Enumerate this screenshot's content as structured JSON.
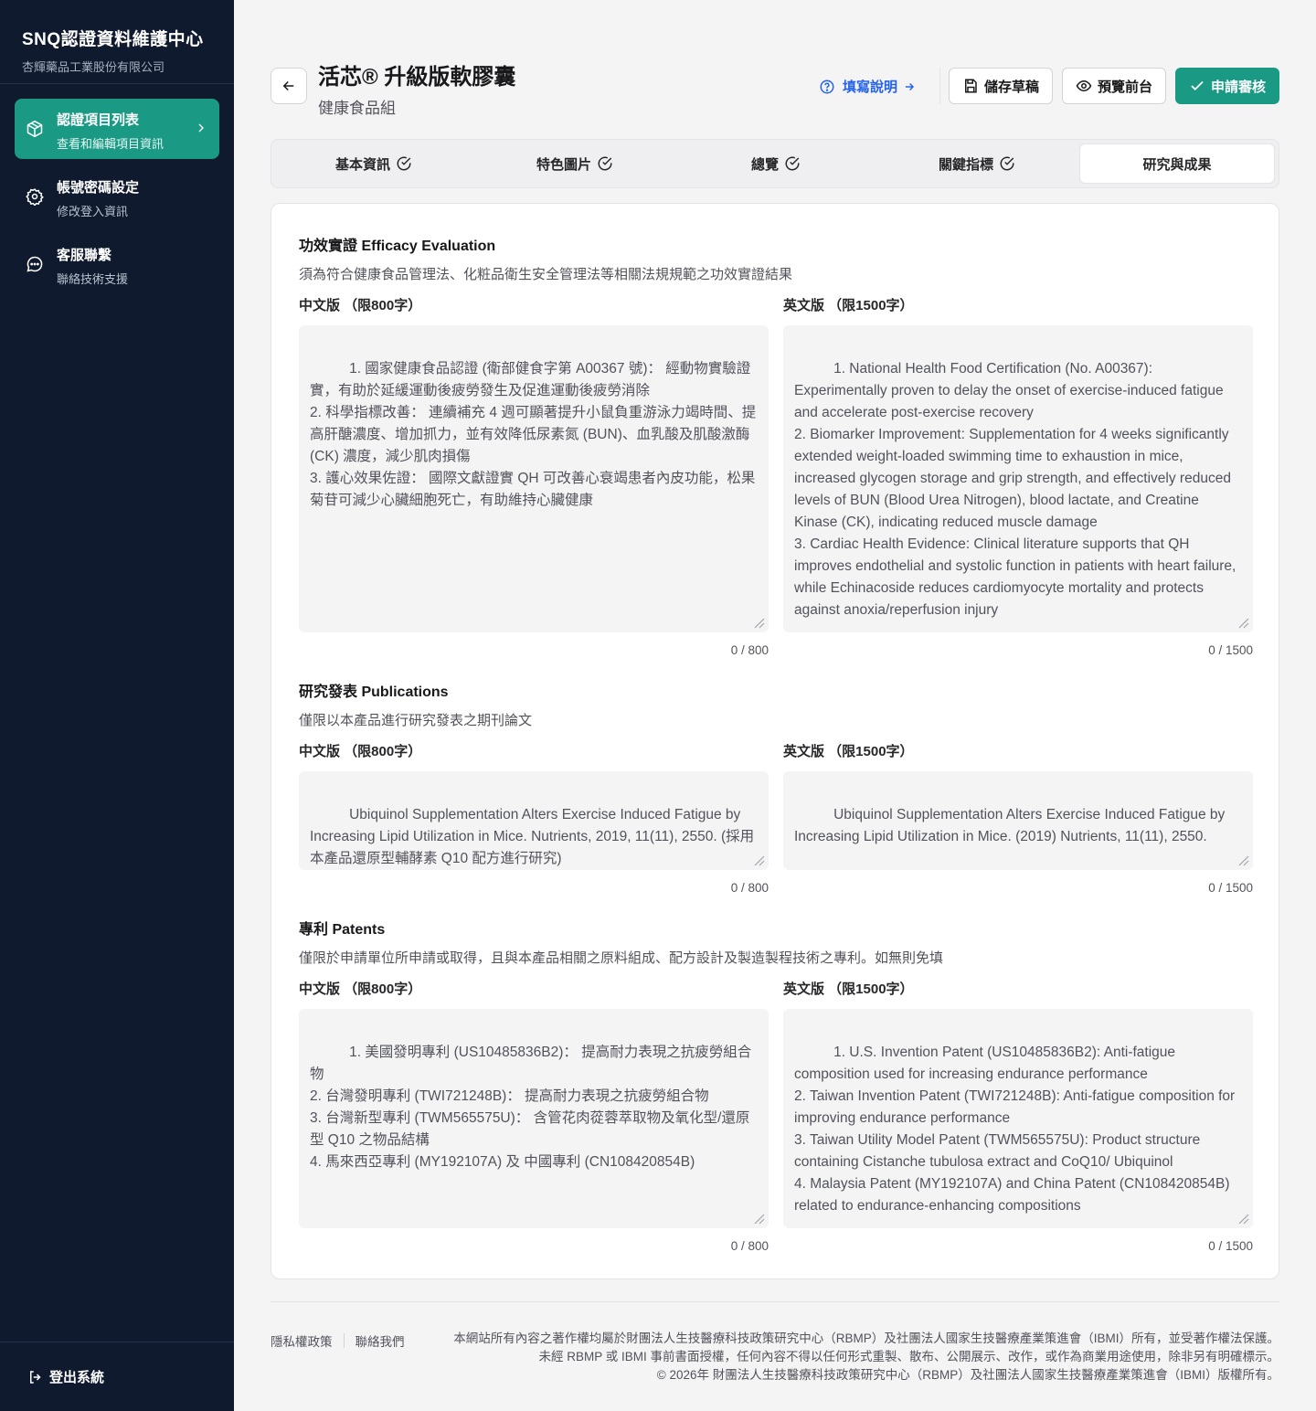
{
  "sidebar": {
    "brand_title": "SNQ認證資料維護中心",
    "brand_sub": "杏輝藥品工業股份有限公司",
    "items": [
      {
        "label": "認證項目列表",
        "sub": "查看和編輯項目資訊",
        "icon": "box-icon",
        "active": true
      },
      {
        "label": "帳號密碼設定",
        "sub": "修改登入資訊",
        "icon": "gear-icon",
        "active": false
      },
      {
        "label": "客服聯繫",
        "sub": "聯絡技術支援",
        "icon": "chat-icon",
        "active": false
      }
    ],
    "logout_label": "登出系統"
  },
  "header": {
    "title": "活芯® 升級版軟膠囊",
    "subtitle": "健康食品組",
    "help_label": "填寫說明",
    "save_label": "儲存草稿",
    "preview_label": "預覽前台",
    "submit_label": "申請審核"
  },
  "tabs": [
    {
      "label": "基本資訊",
      "done": true
    },
    {
      "label": "特色圖片",
      "done": true
    },
    {
      "label": "總覽",
      "done": true
    },
    {
      "label": "關鍵指標",
      "done": true
    },
    {
      "label": "研究與成果",
      "done": false,
      "active": true
    }
  ],
  "sections": {
    "efficacy": {
      "title": "功效實證 Efficacy Evaluation",
      "desc": "須為符合健康食品管理法、化粧品衛生安全管理法等相關法規規範之功效實證結果",
      "zh_label": "中文版 （限800字）",
      "en_label": "英文版 （限1500字）",
      "zh_text": "1. 國家健康食品認證 (衛部健食字第 A00367 號)： 經動物實驗證實，有助於延緩運動後疲勞發生及促進運動後疲勞消除\n2. 科學指標改善： 連續補充 4 週可顯著提升小鼠負重游泳力竭時間、提高肝醣濃度、增加抓力，並有效降低尿素氮 (BUN)、血乳酸及肌酸激酶 (CK) 濃度，減少肌肉損傷\n3. 護心效果佐證： 國際文獻證實 QH 可改善心衰竭患者內皮功能，松果菊苷可減少心臟細胞死亡，有助維持心臟健康",
      "en_text": "1. National Health Food Certification (No. A00367): Experimentally proven to delay the onset of exercise-induced fatigue and accelerate post-exercise recovery\n2. Biomarker Improvement: Supplementation for 4 weeks significantly extended weight-loaded swimming time to exhaustion in mice, increased glycogen storage and grip strength, and effectively reduced levels of BUN (Blood Urea Nitrogen), blood lactate, and Creatine Kinase (CK), indicating reduced muscle damage\n3. Cardiac Health Evidence: Clinical literature supports that QH improves endothelial and systolic function in patients with heart failure, while Echinacoside reduces cardiomyocyte mortality and protects against anoxia/reperfusion injury",
      "zh_count": "0 / 800",
      "en_count": "0 / 1500"
    },
    "publications": {
      "title": "研究發表 Publications",
      "desc": "僅限以本產品進行研究發表之期刊論文",
      "zh_label": "中文版 （限800字）",
      "en_label": "英文版 （限1500字）",
      "zh_text": "Ubiquinol Supplementation Alters Exercise Induced Fatigue by Increasing Lipid Utilization in Mice. Nutrients, 2019, 11(11), 2550. (採用本產品還原型輔酵素 Q10 配方進行研究)",
      "en_text": "Ubiquinol Supplementation Alters Exercise Induced Fatigue by Increasing Lipid Utilization in Mice. (2019) Nutrients, 11(11), 2550.",
      "zh_count": "0 / 800",
      "en_count": "0 / 1500"
    },
    "patents": {
      "title": "專利 Patents",
      "desc": "僅限於申請單位所申請或取得，且與本產品相關之原料組成、配方設計及製造製程技術之專利。如無則免填",
      "zh_label": "中文版 （限800字）",
      "en_label": "英文版 （限1500字）",
      "zh_text": "1. 美國發明專利 (US10485836B2)： 提高耐力表現之抗疲勞組合物\n2. 台灣發明專利 (TWI721248B)： 提高耐力表現之抗疲勞組合物\n3. 台灣新型專利 (TWM565575U)： 含管花肉蓯蓉萃取物及氧化型/還原型 Q10 之物品結構\n4. 馬來西亞專利 (MY192107A) 及 中國專利 (CN108420854B)",
      "en_text": "1. U.S. Invention Patent (US10485836B2): Anti-fatigue composition used for increasing endurance performance\n2. Taiwan Invention Patent (TWI721248B): Anti-fatigue composition for improving endurance performance\n3. Taiwan Utility Model Patent (TWM565575U): Product structure containing Cistanche tubulosa extract and CoQ10/ Ubiquinol\n4. Malaysia Patent (MY192107A) and China Patent (CN108420854B) related to endurance-enhancing compositions",
      "zh_count": "0 / 800",
      "en_count": "0 / 1500"
    }
  },
  "footer": {
    "privacy": "隱私權政策",
    "contact": "聯絡我們",
    "line1": "本網站所有內容之著作權均屬於財團法人生技醫療科技政策研究中心（RBMP）及社團法人國家生技醫療產業策進會（IBMI）所有，並受著作權法保護。未經 RBMP 或 IBMI 事前書面授權，任何內容不得以任何形式重製、散布、公開展示、改作，或作為商業用途使用，除非另有明確標示。",
    "line2": "© 2026年 財團法人生技醫療科技政策研究中心（RBMP）及社團法人國家生技醫療產業策進會（IBMI）版權所有。"
  },
  "colors": {
    "sidebar_bg": "#0f1a2e",
    "accent": "#1a9a85",
    "link": "#2563eb"
  }
}
